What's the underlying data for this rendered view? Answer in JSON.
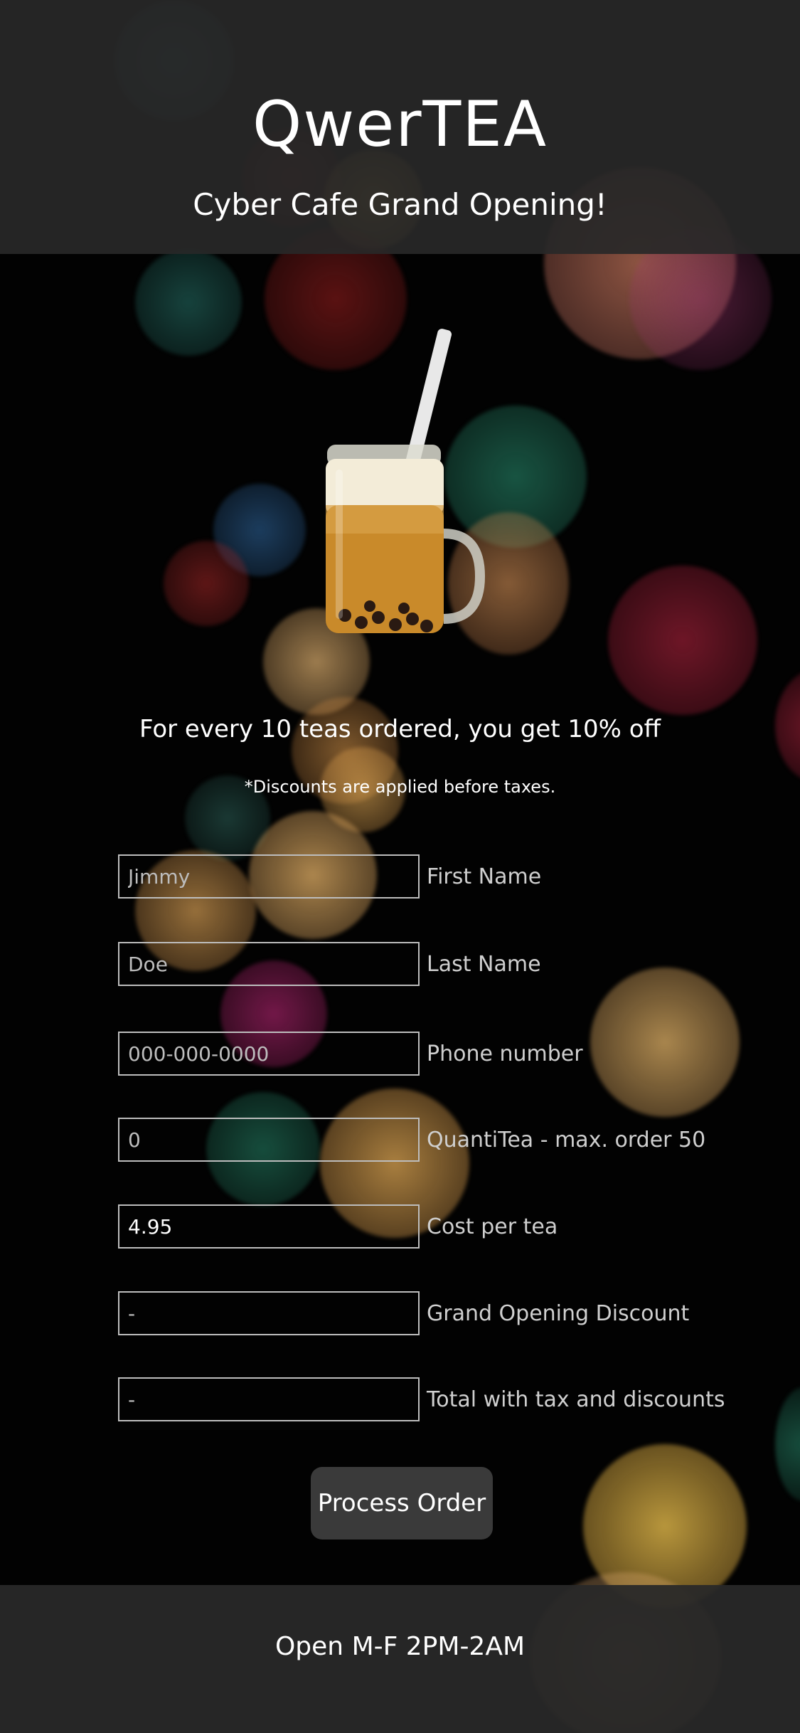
{
  "header": {
    "brand": "QwerTEA",
    "subtitle": "Cyber Cafe Grand Opening!"
  },
  "promo": {
    "headline": "For every 10 teas ordered, you get 10% off",
    "disclaimer": "*Discounts are applied before taxes."
  },
  "form": {
    "first_name": {
      "value": "",
      "placeholder": "Jimmy",
      "label": "First Name"
    },
    "last_name": {
      "value": "",
      "placeholder": "Doe",
      "label": "Last Name"
    },
    "phone": {
      "value": "",
      "placeholder": "000-000-0000",
      "label": "Phone number"
    },
    "quantity": {
      "value": "",
      "placeholder": "0",
      "label": "QuantiTea - max. order 50"
    },
    "cost_per_tea": {
      "value": "4.95",
      "label": "Cost per tea"
    },
    "discount": {
      "value": "",
      "placeholder": "-",
      "label": "Grand Opening Discount"
    },
    "total": {
      "value": "",
      "placeholder": "-",
      "label": "Total with tax and discounts"
    }
  },
  "actions": {
    "process_label": "Process Order"
  },
  "footer": {
    "hours": "Open M-F 2PM-2AM"
  },
  "colors": {
    "header_bg": "#282828",
    "page_bg": "#020202",
    "button_bg": "#3a3a3a",
    "input_border": "#bdbdbd"
  },
  "icons": {
    "hero_image": "bubble-tea-jar"
  }
}
